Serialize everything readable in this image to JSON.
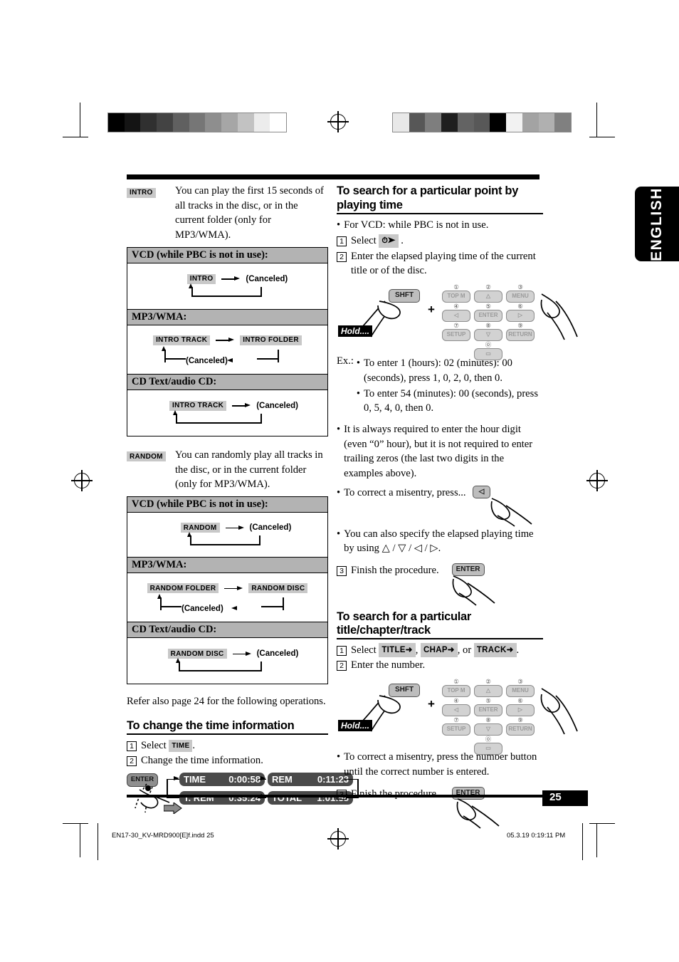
{
  "meta": {
    "language_tab": "ENGLISH",
    "page_number": "25",
    "footer_left": "EN17-30_KV-MRD900[E]f.indd   25",
    "footer_right": "05.3.19   0:19:11 PM"
  },
  "colorbars": {
    "left": [
      "#000000",
      "#141414",
      "#303030",
      "#434343",
      "#606060",
      "#767676",
      "#8e8e8e",
      "#a6a6a6",
      "#c2c2c2",
      "#ececec",
      "#ffffff"
    ],
    "right": [
      "#e8e8e8",
      "#575757",
      "#7e7e7e",
      "#1e1e1e",
      "#636363",
      "#585858",
      "#000000",
      "#f2f2f2",
      "#a3a3a3",
      "#b0b0b0",
      "#808080"
    ]
  },
  "left_column": {
    "intro": {
      "badge": "INTRO",
      "text": "You can play the first 15 seconds of all tracks in the disc, or in the current folder (only for MP3/WMA).",
      "table": [
        {
          "header": "VCD (while PBC is not in use):",
          "nodes": [
            "INTRO"
          ],
          "canceled": "(Canceled)",
          "layout": "single"
        },
        {
          "header": "MP3/WMA:",
          "nodes": [
            "INTRO TRACK",
            "INTRO FOLDER"
          ],
          "canceled": "(Canceled)",
          "layout": "double"
        },
        {
          "header": "CD Text/audio CD:",
          "nodes": [
            "INTRO TRACK"
          ],
          "canceled": "(Canceled)",
          "layout": "single"
        }
      ]
    },
    "random": {
      "badge": "RANDOM",
      "text": "You can randomly play all tracks in the disc, or in the current folder (only for MP3/WMA).",
      "table": [
        {
          "header": "VCD (while PBC is not in use):",
          "nodes": [
            "RANDOM"
          ],
          "canceled": "(Canceled)",
          "layout": "single"
        },
        {
          "header": "MP3/WMA:",
          "nodes": [
            "RANDOM FOLDER",
            "RANDOM DISC"
          ],
          "canceled": "(Canceled)",
          "layout": "double"
        },
        {
          "header": "CD Text/audio CD:",
          "nodes": [
            "RANDOM DISC"
          ],
          "canceled": "(Canceled)",
          "layout": "single"
        }
      ]
    },
    "refer_note": "Refer also page 24 for the following operations.",
    "time_info": {
      "heading": "To change the time information",
      "step1_num": "1",
      "step1_text": "Select",
      "step1_badge": "TIME",
      "step1_period": ".",
      "step2_num": "2",
      "step2_text": "Change the time information.",
      "enter_key": "ENTER",
      "displays": [
        {
          "label": "TIME",
          "value": "0:00:58"
        },
        {
          "label": "REM",
          "value": "0:11:23"
        },
        {
          "label": "T. REM",
          "value": "0:35:24"
        },
        {
          "label": "TOTAL",
          "value": "1:01:58"
        }
      ]
    }
  },
  "right_column": {
    "section1": {
      "heading": "To search for a particular point by playing time",
      "bullet_vcd": "For VCD: while PBC is not in use.",
      "step1_num": "1",
      "step1_text": "Select",
      "step1_badge_icon": "clock-arrow-icon",
      "step1_period": ".",
      "step2_num": "2",
      "step2_text": "Enter the elapsed playing time of the current title or of the disc.",
      "keypad": {
        "hold_label": "Hold....",
        "shift_label": "SHFT",
        "plus": "+",
        "keys": [
          {
            "num": "①",
            "label": "TOP M"
          },
          {
            "num": "②",
            "label": "△"
          },
          {
            "num": "③",
            "label": "MENU"
          },
          {
            "num": "④",
            "label": "◁"
          },
          {
            "num": "⑤",
            "label": "ENTER"
          },
          {
            "num": "⑥",
            "label": "▷"
          },
          {
            "num": "⑦",
            "label": "SETUP"
          },
          {
            "num": "⑧",
            "label": "▽"
          },
          {
            "num": "⑨",
            "label": "RETURN"
          },
          {
            "num": "⓪",
            "label": "▭"
          }
        ]
      },
      "example_label": "Ex.:",
      "examples": [
        "To enter 1 (hours): 02 (minutes): 00 (seconds), press 1, 0, 2, 0, then 0.",
        "To enter 54 (minutes): 00 (seconds), press 0, 5, 4, 0, then 0."
      ],
      "note_hour": "It is always required to enter the hour digit (even “0” hour), but it is not required to enter trailing zeros (the last two digits in the examples above).",
      "note_misentry": "To correct a misentry, press...",
      "misentry_key": "◁",
      "note_specify": "You can also specify the elapsed playing time by using △ / ▽ / ◁ / ▷.",
      "step3_num": "3",
      "step3_text": "Finish the procedure.",
      "step3_key": "ENTER"
    },
    "section2": {
      "heading": "To search for a particular title/chapter/track",
      "step1_num": "1",
      "step1_text": "Select",
      "step1_badges": [
        "TITLE➜",
        "CHAP➜",
        "TRACK➜"
      ],
      "step1_sep": ", ",
      "step1_or": ", or ",
      "step1_period": ".",
      "step2_num": "2",
      "step2_text": "Enter the number.",
      "keypad": {
        "hold_label": "Hold....",
        "shift_label": "SHFT",
        "plus": "+",
        "keys": [
          {
            "num": "①",
            "label": "TOP M"
          },
          {
            "num": "②",
            "label": "△"
          },
          {
            "num": "③",
            "label": "MENU"
          },
          {
            "num": "④",
            "label": "◁"
          },
          {
            "num": "⑤",
            "label": "ENTER"
          },
          {
            "num": "⑥",
            "label": "▷"
          },
          {
            "num": "⑦",
            "label": "SETUP"
          },
          {
            "num": "⑧",
            "label": "▽"
          },
          {
            "num": "⑨",
            "label": "RETURN"
          },
          {
            "num": "⓪",
            "label": "▭"
          }
        ]
      },
      "note_misentry": "To correct a misentry, press the number button until the correct number is entered.",
      "step3_num": "3",
      "step3_text": "Finish the procedure.",
      "step3_key": "ENTER"
    }
  }
}
